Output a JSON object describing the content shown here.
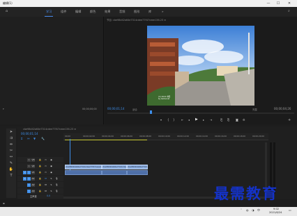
{
  "titlebar": {
    "title": "编辑(1)",
    "min": "—",
    "max": "☐",
    "close": "✕"
  },
  "menu": {
    "items": [
      "学习",
      "组件",
      "编辑",
      "颜色",
      "效果",
      "音频",
      "图形",
      "库"
    ],
    "active_index": 0,
    "more": "»"
  },
  "left_panel": {
    "timecode": "00;00;00;00"
  },
  "program": {
    "tab_label": "节目: cbe98d42a64e7314cdee77f47ceee136-23 ≡",
    "current_time": "00;00;01;14",
    "fit_label": "适合",
    "quality_label": "完整",
    "duration": "00;00;04;26",
    "watermark_line1": "(C) 2021·中国",
    "watermark_line2": "by beitunnel",
    "plus": "+"
  },
  "sequence": {
    "tab_label": "cbe98d42a64e7314cdee77f47ceee136-23 ≡",
    "timecode": "00;00;01;14",
    "ruler_labels": [
      "00;00",
      "00;00;02;00",
      "00;00;04;00",
      "00;00;06;00",
      "00;00;08;00",
      "00;00;10;00",
      "00;00;12;00",
      "00;00;14;00",
      "00;00;16;00",
      "00;00;18;00",
      "00;00;20;00",
      "00;00;22;00"
    ],
    "tracks": [
      {
        "name": "V3",
        "label": "V3",
        "type": "video"
      },
      {
        "name": "V2",
        "label": "V2",
        "type": "video"
      },
      {
        "name": "V1",
        "label": "V1",
        "type": "video"
      },
      {
        "name": "A1",
        "label": "A1",
        "type": "audio"
      },
      {
        "name": "A2",
        "label": "A2",
        "type": "audio"
      },
      {
        "name": "A3",
        "label": "A3",
        "type": "audio"
      },
      {
        "name": "主声道",
        "label": "主声道",
        "type": "master"
      }
    ],
    "master_value": "0.0",
    "clips": [
      {
        "label": "cbe98d42a64e7314cdee77f47ceee136-23.mp4"
      },
      {
        "label": "cbe98d42a64e7314cdee77f47ceee136-23.mp4"
      },
      {
        "label": "cbe98d42a64e7314cdee77f47ceee136-23.mp4"
      }
    ]
  },
  "taskbar": {
    "time": "9:02",
    "date": "2021/6/24"
  },
  "watermark": "最需教育",
  "colors": {
    "accent": "#4a8df0",
    "clip_video": "#8fb0e0",
    "clip_audio": "#4e6fa8",
    "timecode_blue": "#3d8eea"
  }
}
